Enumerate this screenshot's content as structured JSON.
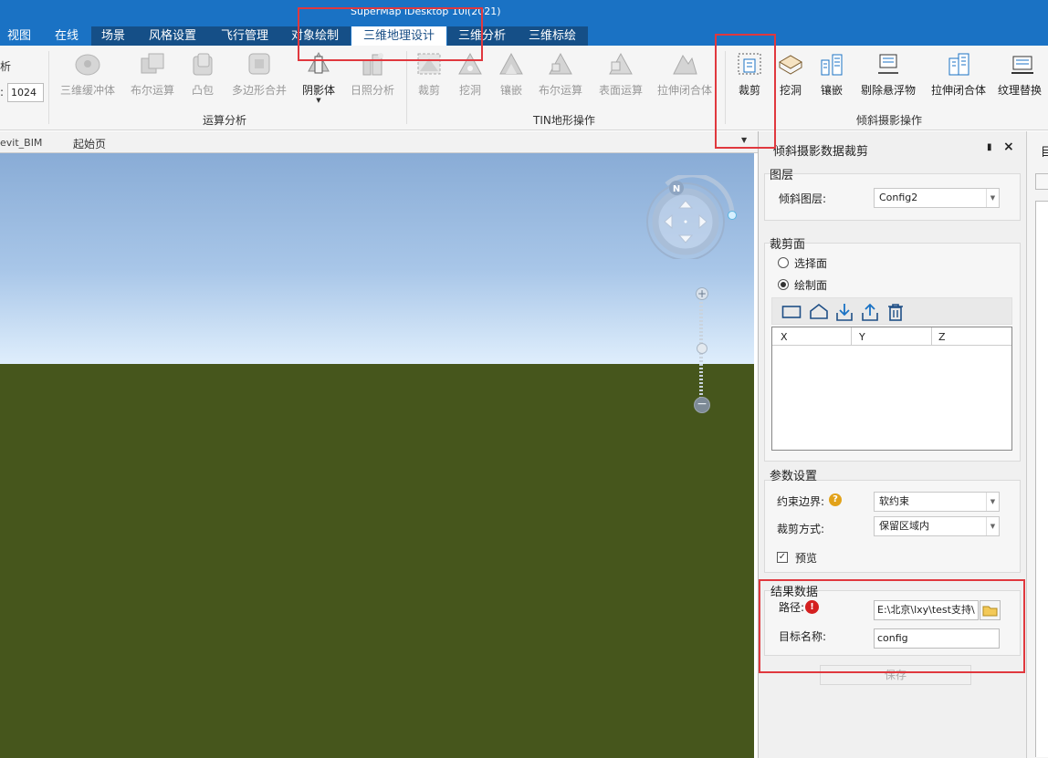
{
  "app": {
    "title": "SuperMap iDesktop 10i(2021)"
  },
  "menu": {
    "tabs": [
      {
        "label": "视图"
      },
      {
        "label": "在线"
      },
      {
        "label": "场景"
      },
      {
        "label": "风格设置"
      },
      {
        "label": "飞行管理"
      },
      {
        "label": "对象绘制"
      },
      {
        "label": "三维地理设计"
      },
      {
        "label": "三维分析"
      },
      {
        "label": "三维标绘"
      }
    ],
    "active_tab": "三维地理设计"
  },
  "ribbon": {
    "left_partial_label": "析",
    "left_input_value": "1024",
    "groups": {
      "operation_analysis": {
        "title": "运算分析",
        "buttons": [
          "三维缓冲体",
          "布尔运算",
          "凸包",
          "多边形合并",
          "阴影体",
          "日照分析"
        ]
      },
      "tin": {
        "title": "TIN地形操作",
        "buttons": [
          "裁剪",
          "挖洞",
          "镶嵌",
          "布尔运算",
          "表面运算",
          "拉伸闭合体"
        ]
      },
      "oblique": {
        "title": "倾斜摄影操作",
        "buttons": [
          "裁剪",
          "挖洞",
          "镶嵌",
          "剔除悬浮物",
          "拉伸闭合体",
          "纹理替换"
        ]
      }
    }
  },
  "doc_tabs": [
    {
      "label": "evit_BIM"
    },
    {
      "label": "起始页"
    }
  ],
  "compass": {
    "north_label": "N"
  },
  "panel": {
    "title": "倾斜摄影数据裁剪",
    "pin_icon": "pin-icon",
    "close_icon": "close-icon",
    "layer_group": {
      "title": "图层",
      "oblique_layer_label": "倾斜图层:",
      "oblique_layer_value": "Config2"
    },
    "clip_surface": {
      "title": "裁剪面",
      "option_select": "选择面",
      "option_draw": "绘制面",
      "selected": "绘制面",
      "table_columns": [
        "X",
        "Y",
        "Z"
      ]
    },
    "params": {
      "title": "参数设置",
      "constraint_label": "约束边界:",
      "constraint_value": "软约束",
      "clip_mode_label": "裁剪方式:",
      "clip_mode_value": "保留区域内",
      "preview_label": "预览",
      "preview_checked": true
    },
    "result": {
      "title": "结果数据",
      "path_label": "路径:",
      "path_value": "E:\\北京\\lxy\\test支持\\",
      "target_name_label": "目标名称:",
      "target_name_value": "config"
    },
    "save_button": "保存"
  },
  "right_strip": {
    "label": "目"
  },
  "colors": {
    "title_bar": "#1a72c4",
    "annotation_box": "#e0383e",
    "ground": "#46561c",
    "sky_top": "#89acd6"
  }
}
